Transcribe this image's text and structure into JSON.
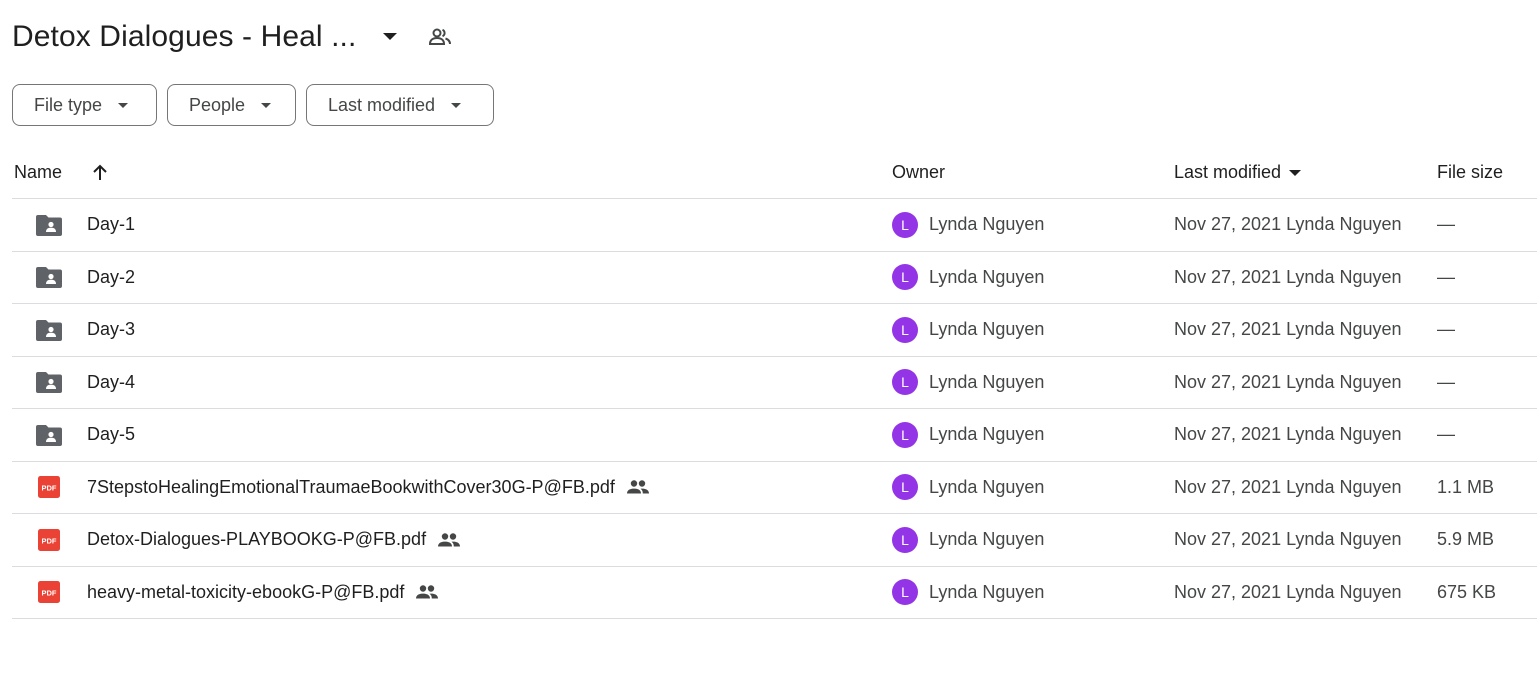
{
  "header": {
    "title": "Detox Dialogues - Heal ..."
  },
  "filters": [
    {
      "label": "File type"
    },
    {
      "label": "People"
    },
    {
      "label": "Last modified"
    }
  ],
  "table": {
    "columns": {
      "name": "Name",
      "owner": "Owner",
      "last_modified": "Last modified",
      "file_size": "File size"
    },
    "rows": [
      {
        "type": "shared-folder",
        "name": "Day-1",
        "shared": false,
        "owner_initial": "L",
        "owner": "Lynda Nguyen",
        "modified": "Nov 27, 2021 Lynda Nguyen",
        "size": "—"
      },
      {
        "type": "shared-folder",
        "name": "Day-2",
        "shared": false,
        "owner_initial": "L",
        "owner": "Lynda Nguyen",
        "modified": "Nov 27, 2021 Lynda Nguyen",
        "size": "—"
      },
      {
        "type": "shared-folder",
        "name": "Day-3",
        "shared": false,
        "owner_initial": "L",
        "owner": "Lynda Nguyen",
        "modified": "Nov 27, 2021 Lynda Nguyen",
        "size": "—"
      },
      {
        "type": "shared-folder",
        "name": "Day-4",
        "shared": false,
        "owner_initial": "L",
        "owner": "Lynda Nguyen",
        "modified": "Nov 27, 2021 Lynda Nguyen",
        "size": "—"
      },
      {
        "type": "shared-folder",
        "name": "Day-5",
        "shared": false,
        "owner_initial": "L",
        "owner": "Lynda Nguyen",
        "modified": "Nov 27, 2021 Lynda Nguyen",
        "size": "—"
      },
      {
        "type": "pdf",
        "name": "7StepstoHealingEmotionalTraumaeBookwithCover30G-P@FB.pdf",
        "shared": true,
        "owner_initial": "L",
        "owner": "Lynda Nguyen",
        "modified": "Nov 27, 2021 Lynda Nguyen",
        "size": "1.1 MB"
      },
      {
        "type": "pdf",
        "name": "Detox-Dialogues-PLAYBOOKG-P@FB.pdf",
        "shared": true,
        "owner_initial": "L",
        "owner": "Lynda Nguyen",
        "modified": "Nov 27, 2021 Lynda Nguyen",
        "size": "5.9 MB"
      },
      {
        "type": "pdf",
        "name": "heavy-metal-toxicity-ebookG-P@FB.pdf",
        "shared": true,
        "owner_initial": "L",
        "owner": "Lynda Nguyen",
        "modified": "Nov 27, 2021 Lynda Nguyen",
        "size": "675 KB"
      }
    ]
  },
  "icons": {
    "folder": "shared-folder-icon",
    "pdf": "pdf-icon",
    "shared": "people-icon",
    "sort": "arrow-up-icon",
    "dropdown": "caret-down-icon"
  },
  "colors": {
    "avatar": "#9334e6",
    "pdf": "#ea4335",
    "folder": "#5f6368"
  }
}
